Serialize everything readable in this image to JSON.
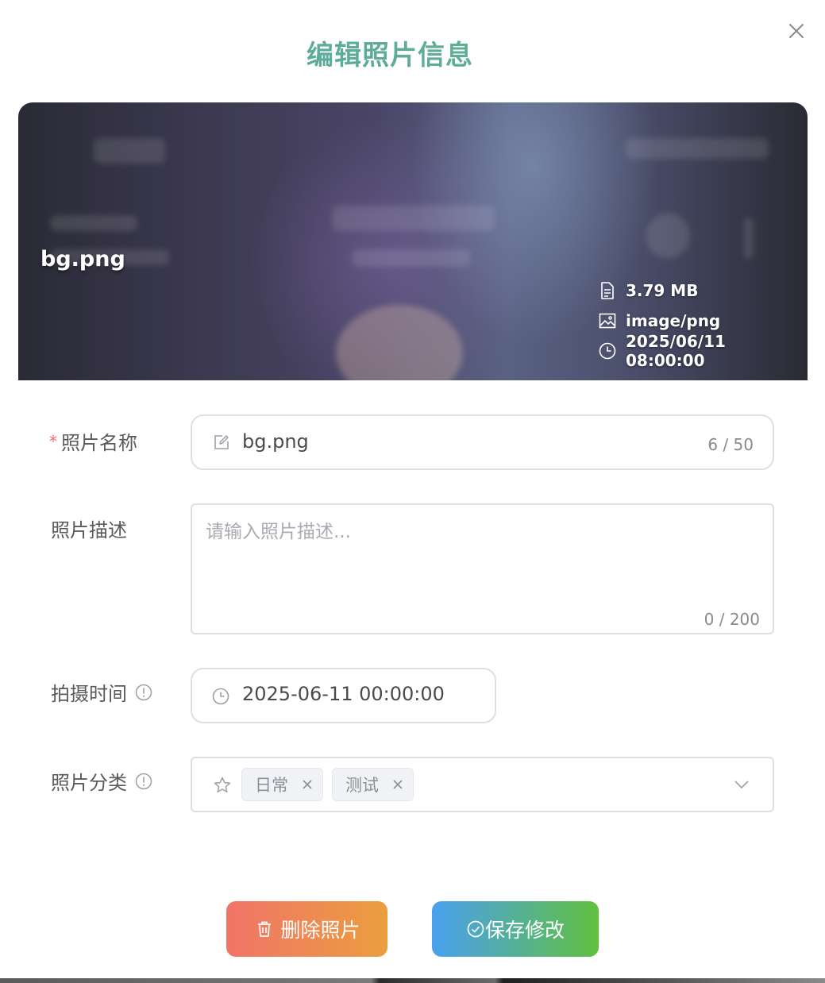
{
  "dialog": {
    "title": "编辑照片信息",
    "close_icon": "close-icon"
  },
  "preview": {
    "file_name": "bg.png",
    "size": "3.79 MB",
    "mime_type": "image/png",
    "timestamp": "2025/06/11 08:00:00",
    "icons": {
      "size": "file-icon",
      "type": "image-icon",
      "time": "clock-icon"
    }
  },
  "form": {
    "name": {
      "label": "照片名称",
      "required_mark": "*",
      "value": "bg.png",
      "counter": "6 / 50",
      "icon": "edit-icon"
    },
    "description": {
      "label": "照片描述",
      "placeholder": "请输入照片描述...",
      "value": "",
      "counter": "0 / 200"
    },
    "shot_time": {
      "label": "拍摄时间",
      "value": "2025-06-11 00:00:00",
      "icon": "clock-icon",
      "info_icon": "info-icon"
    },
    "category": {
      "label": "照片分类",
      "icon": "star-icon",
      "info_icon": "info-icon",
      "tags": [
        "日常",
        "测试"
      ],
      "dropdown_icon": "chevron-down-icon"
    }
  },
  "actions": {
    "delete_label": "删除照片",
    "save_label": "保存修改"
  },
  "colors": {
    "title_gradient": [
      "#59a9a2",
      "#61b08e"
    ],
    "delete_gradient": [
      "#f07468",
      "#eb9e3e"
    ],
    "save_gradient": [
      "#4aa0f0",
      "#60c03e"
    ],
    "required": "#f56c6c",
    "border": "#dcdfe6"
  }
}
